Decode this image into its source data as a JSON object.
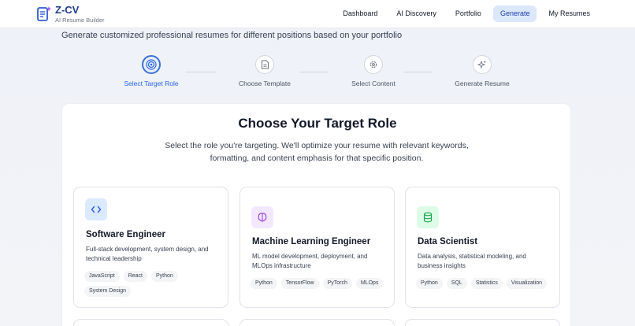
{
  "app": {
    "title": "Z-CV",
    "subtitle": "AI Resume Builder"
  },
  "nav": [
    {
      "label": "Dashboard",
      "active": false
    },
    {
      "label": "AI Discovery",
      "active": false
    },
    {
      "label": "Portfolio",
      "active": false
    },
    {
      "label": "Generate",
      "active": true
    },
    {
      "label": "My Resumes",
      "active": false
    }
  ],
  "page": {
    "subtitle": "Generate customized professional resumes for different positions based on your portfolio"
  },
  "steps": [
    {
      "label": "Select Target Role",
      "icon": "target-icon",
      "active": true
    },
    {
      "label": "Choose Template",
      "icon": "document-icon",
      "active": false
    },
    {
      "label": "Select Content",
      "icon": "gear-icon",
      "active": false
    },
    {
      "label": "Generate Resume",
      "icon": "sparkle-icon",
      "active": false
    }
  ],
  "main": {
    "title": "Choose Your Target Role",
    "description": "Select the role you're targeting. We'll optimize your resume with relevant keywords, formatting, and content emphasis for that specific position."
  },
  "roles": [
    {
      "title": "Software Engineer",
      "icon": "code-icon",
      "description": "Full-stack development, system design, and technical leadership",
      "tags": [
        "JavaScript",
        "React",
        "Python",
        "System Design"
      ],
      "accent": "#dbeafe",
      "icon_color": "#2563eb"
    },
    {
      "title": "Machine Learning Engineer",
      "icon": "brain-icon",
      "description": "ML model development, deployment, and MLOps infrastructure",
      "tags": [
        "Python",
        "TensorFlow",
        "PyTorch",
        "MLOps"
      ],
      "accent": "#f3e8ff",
      "icon_color": "#9333ea"
    },
    {
      "title": "Data Scientist",
      "icon": "database-icon",
      "description": "Data analysis, statistical modeling, and business insights",
      "tags": [
        "Python",
        "SQL",
        "Statistics",
        "Visualization"
      ],
      "accent": "#dcfce7",
      "icon_color": "#16a34a"
    }
  ],
  "colors": {
    "brand": "#1e3a8a",
    "accent": "#2563eb",
    "active_nav_bg": "#dbe7fb"
  }
}
